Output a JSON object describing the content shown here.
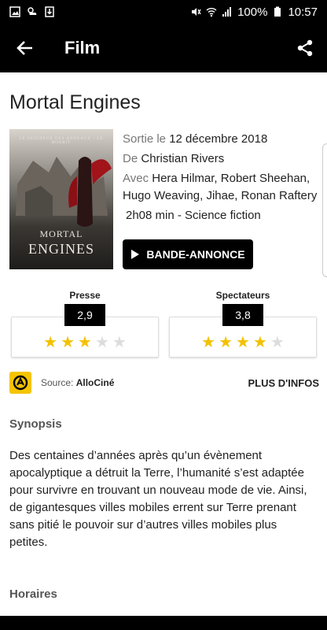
{
  "status": {
    "battery": "100%",
    "time": "10:57"
  },
  "appbar": {
    "title": "Film",
    "back_icon": "arrow-left-icon",
    "share_icon": "share-icon"
  },
  "movie": {
    "title": "Mortal Engines",
    "poster": {
      "tagline": "LE SEIGNEUR DES ANNEAUX • LE HOBBIT",
      "line1": "MORTAL",
      "line2": "ENGINES"
    },
    "release_label": "Sortie le",
    "release_date": "12 décembre 2018",
    "director_label": "De",
    "director": "Christian Rivers",
    "cast_label": "Avec",
    "cast": "Hera Hilmar, Robert Sheehan, Hugo Weaving, Jihae, Ronan Raftery",
    "duration_genre": "2h08 min - Science fiction",
    "trailer_label": "BANDE-ANNONCE"
  },
  "ratings": {
    "press": {
      "label": "Presse",
      "score": "2,9",
      "stars_on": 3,
      "stars_total": 5
    },
    "audience": {
      "label": "Spectateurs",
      "score": "3,8",
      "stars_on": 4,
      "stars_total": 5
    }
  },
  "source": {
    "label": "Source:",
    "name": "AlloCiné",
    "more": "PLUS D'INFOS"
  },
  "synopsis": {
    "title": "Synopsis",
    "text": "Des centaines d’années après qu’un évènement apocalyptique a détruit la Terre, l’humanité s’est adaptée pour survivre en trouvant un nouveau mode de vie. Ainsi, de gigantesques villes mobiles errent sur Terre prenant sans pitié le pouvoir sur d’autres villes mobiles plus petites."
  },
  "horaires": {
    "title": "Horaires"
  },
  "colors": {
    "bar": "#000000",
    "star_on": "#f2c200",
    "star_off": "#dddddd",
    "allocine": "#f4c400"
  }
}
